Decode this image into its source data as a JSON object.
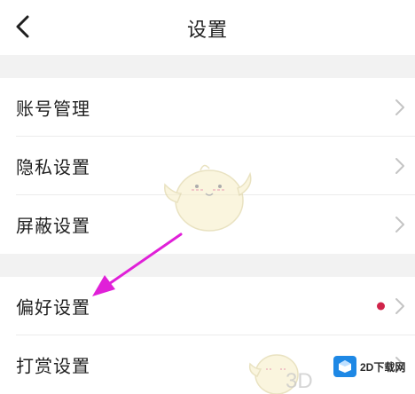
{
  "header": {
    "title": "设置",
    "back_icon": "chevron-left-icon"
  },
  "settings_groups": [
    {
      "items": [
        {
          "label": "账号管理",
          "icon": "chevron-right-icon"
        },
        {
          "label": "隐私设置",
          "icon": "chevron-right-icon"
        },
        {
          "label": "屏蔽设置",
          "icon": "chevron-right-icon"
        }
      ]
    },
    {
      "items": [
        {
          "label": "偏好设置",
          "icon": "chevron-right-icon",
          "badge": "red-dot"
        },
        {
          "label": "打赏设置",
          "icon": "chevron-right-icon"
        }
      ]
    }
  ],
  "annotation": {
    "arrow_color": "#e020d8",
    "points_to": "偏好设置"
  },
  "watermark": {
    "logo_text": "2D下载网",
    "text": "3D"
  },
  "colors": {
    "background": "#ffffff",
    "section_gap": "#f2f2f2",
    "text": "#1f1f1f",
    "chevron": "#c4c4c4",
    "badge_dot": "#d0244a",
    "arrow": "#e020d8",
    "watermark_blue": "#1e88e5"
  }
}
